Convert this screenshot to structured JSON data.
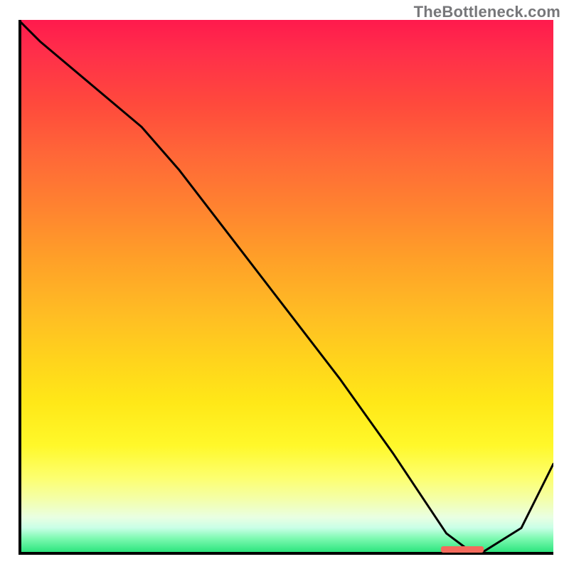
{
  "attribution": "TheBottleneck.com",
  "colors": {
    "gradient_top": "#ff1a4d",
    "gradient_bottom": "#2de57e",
    "axis": "#000000",
    "curve": "#000000",
    "marker": "#f46a5c",
    "attribution_text": "#77777a"
  },
  "chart_data": {
    "type": "line",
    "title": "",
    "xlabel": "",
    "ylabel": "",
    "xlim": [
      0,
      100
    ],
    "ylim": [
      0,
      100
    ],
    "grid": false,
    "legend": false,
    "series": [
      {
        "name": "curve",
        "x": [
          0,
          4,
          23,
          30,
          40,
          50,
          60,
          70,
          76,
          80,
          84,
          86,
          94,
          100
        ],
        "values": [
          100,
          96,
          80,
          72,
          59,
          46,
          33,
          19,
          10,
          4,
          1,
          0,
          5,
          17
        ]
      }
    ],
    "marker": {
      "x_start": 79,
      "x_end": 87,
      "y": 1,
      "height": 1.2
    }
  }
}
